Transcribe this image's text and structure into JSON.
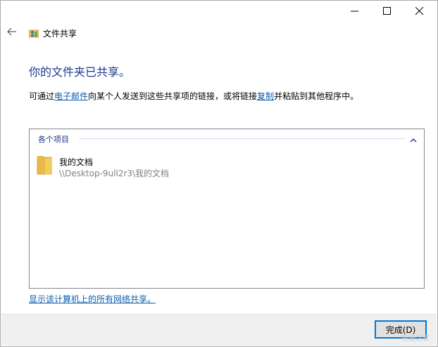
{
  "window": {
    "title": "文件共享",
    "controls": [
      "minimize-icon",
      "maximize-icon",
      "close-icon"
    ]
  },
  "header": {
    "headline": "你的文件夹已共享。",
    "desc_prefix": "可通过",
    "desc_link_email": "电子邮件",
    "desc_mid": "向某个人发送到这些共享项的链接，或将链接",
    "desc_link_copy": "复制",
    "desc_suffix": "并粘贴到其他程序中。"
  },
  "list": {
    "group_label": "各个项目",
    "items": [
      {
        "name": "我的文档",
        "path": "\\\\Desktop-9ull2r3\\我的文档",
        "icon": "folder-icon"
      }
    ]
  },
  "bottom_link": "显示该计算机上的所有网络共享。",
  "footer": {
    "finish_label": "完成(D)"
  },
  "watermark": "系统之家",
  "colors": {
    "headline": "#1b3a8c",
    "link": "#0b5fb1",
    "focus": "#0078d7"
  }
}
